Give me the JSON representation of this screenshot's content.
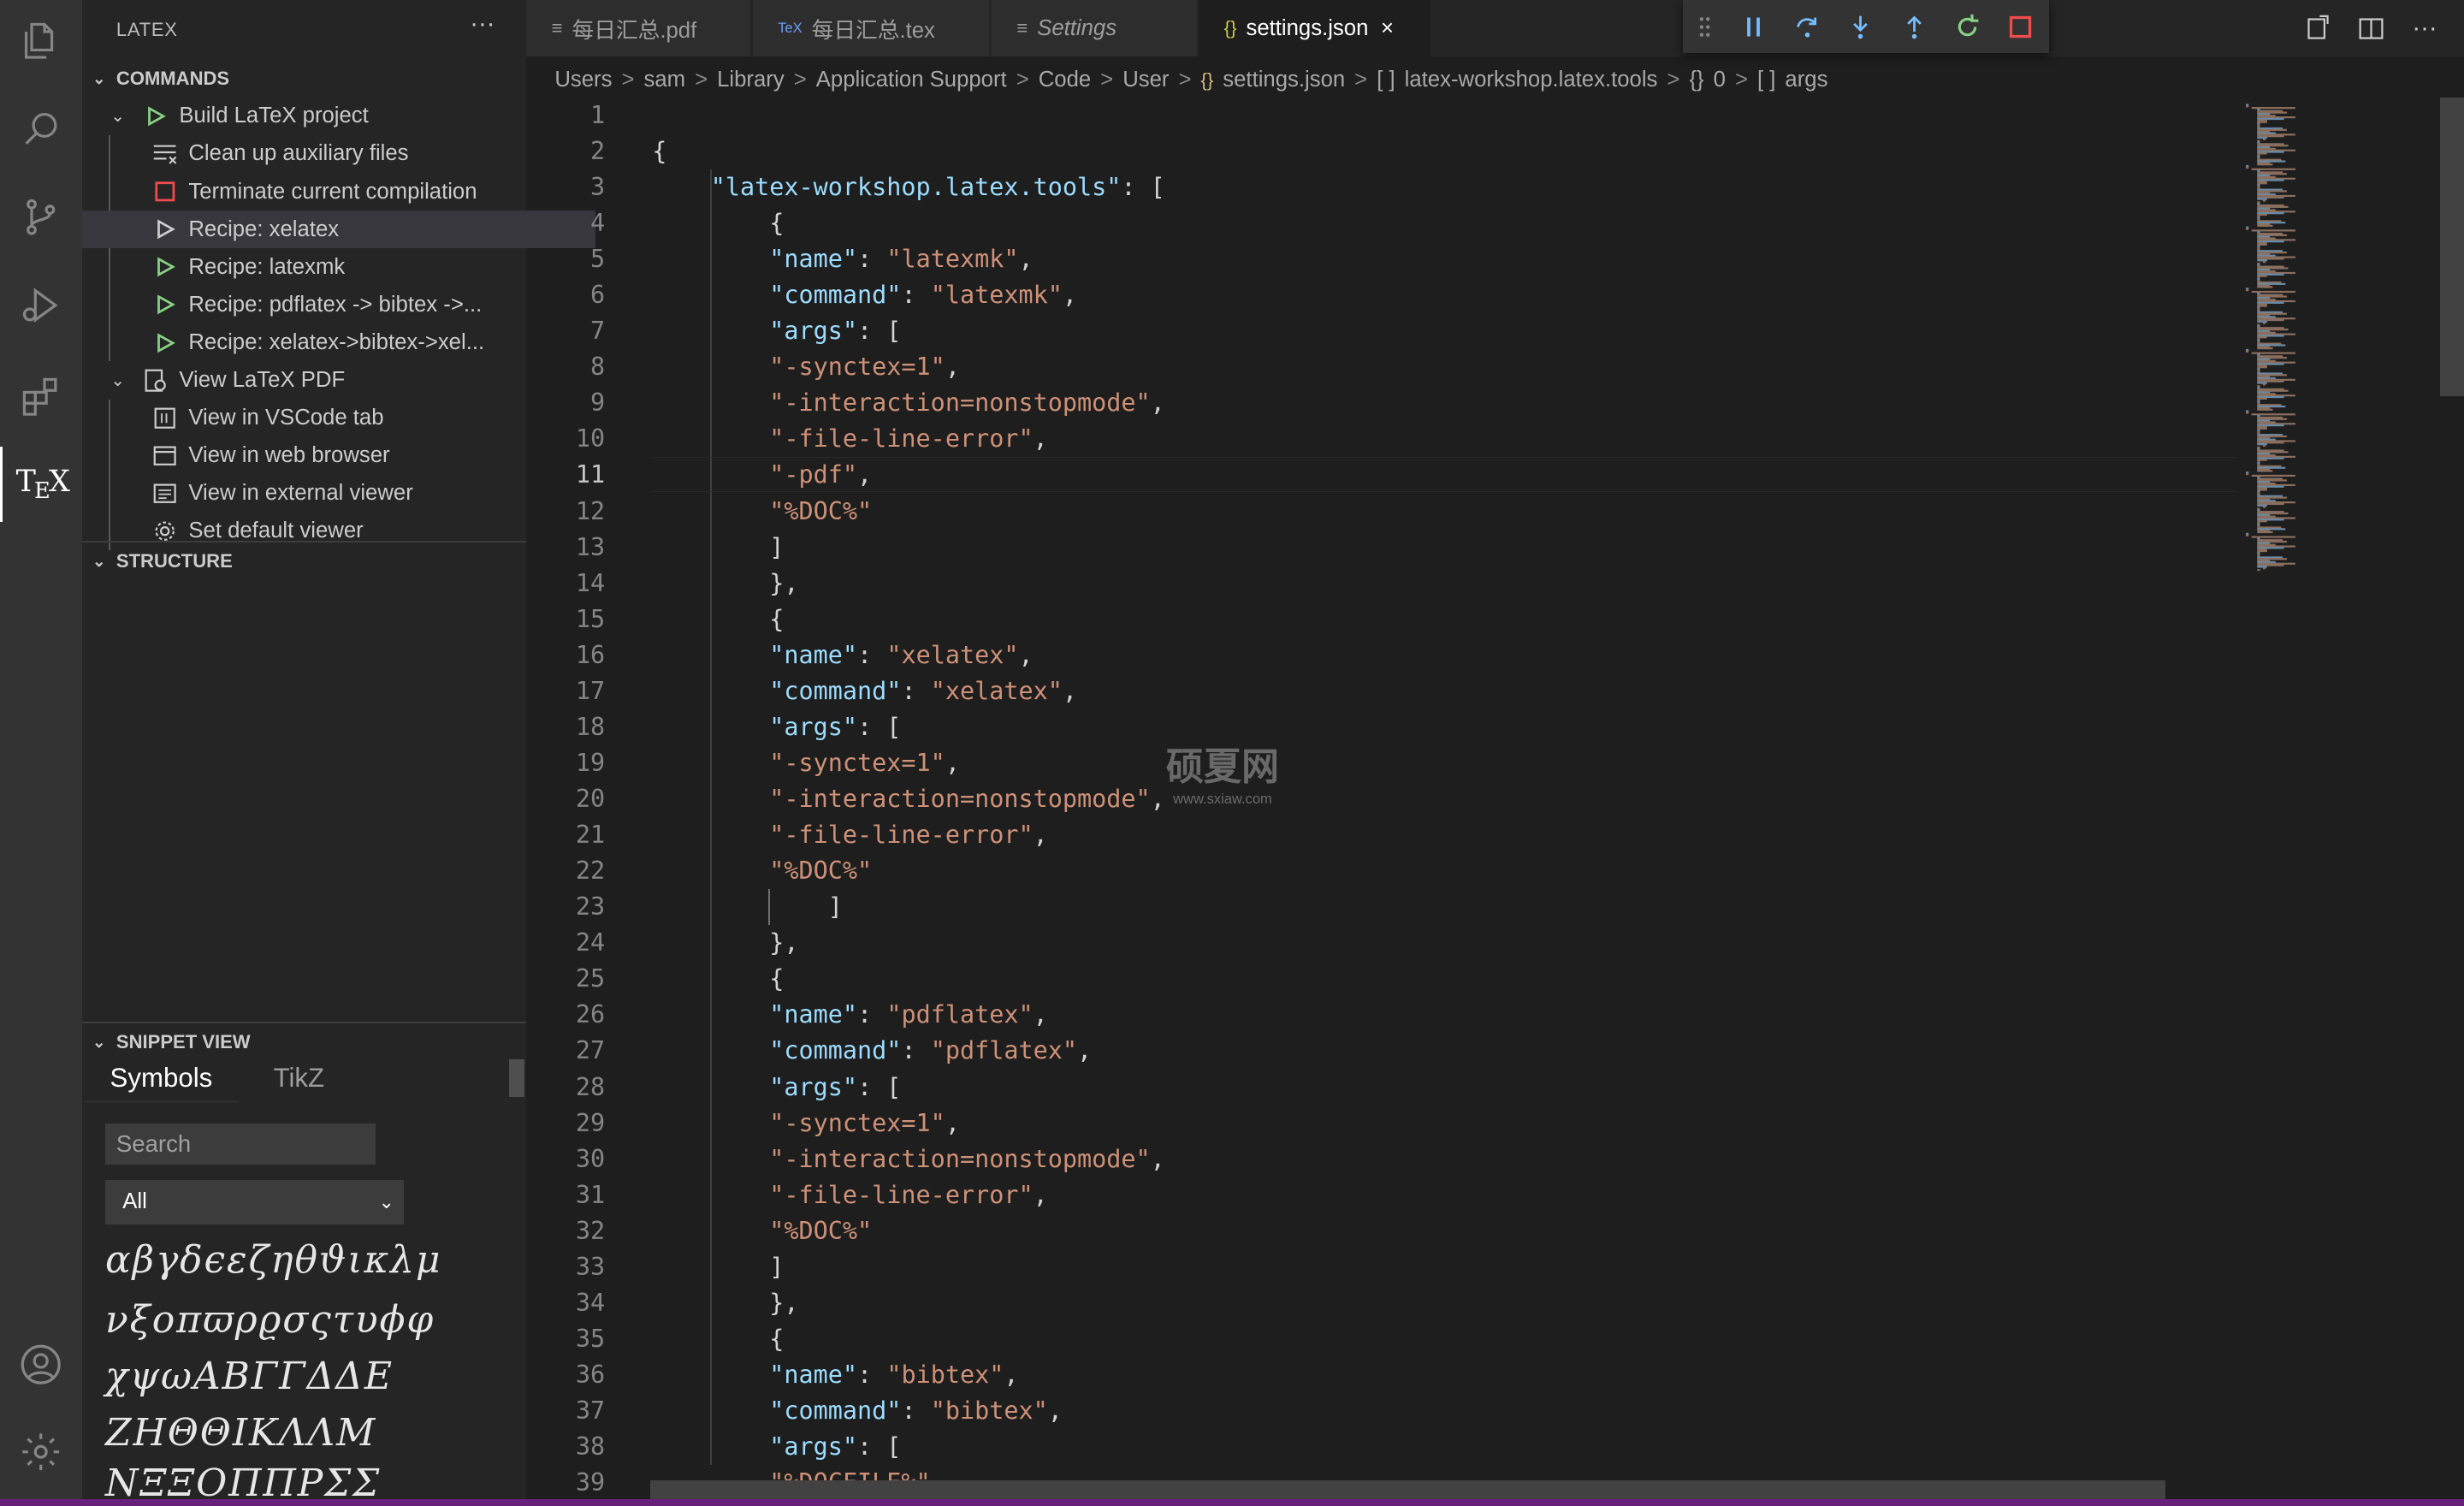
{
  "sidebar": {
    "title": "LATEX",
    "more": "···",
    "commands_section": "COMMANDS",
    "structure_section": "STRUCTURE",
    "snippet_section": "SNIPPET VIEW",
    "items": [
      {
        "label": "Build LaTeX project"
      },
      {
        "label": "Clean up auxiliary files"
      },
      {
        "label": "Terminate current compilation"
      },
      {
        "label": "Recipe: xelatex"
      },
      {
        "label": "Recipe: latexmk"
      },
      {
        "label": "Recipe: pdflatex -> bibtex ->..."
      },
      {
        "label": "Recipe: xelatex->bibtex->xel..."
      },
      {
        "label": "View LaTeX PDF"
      },
      {
        "label": "View in VSCode tab"
      },
      {
        "label": "View in web browser"
      },
      {
        "label": "View in external viewer"
      },
      {
        "label": "Set default viewer"
      }
    ],
    "snippet_tabs": [
      "Symbols",
      "TikZ"
    ],
    "search_placeholder": "Search",
    "filter_value": "All",
    "symbols": [
      "αβγδϵεζηθϑικλμ",
      "νξοπϖρϱσςτυϕφ",
      "χψωΑΒΓΓΔΔΕ",
      "ΖΗΘΘΙΚΛΛΜ",
      "ΝΞΞΟΠΠΡΣΣ"
    ]
  },
  "tabs": [
    {
      "icon": "≡",
      "label": "每日汇总.pdf"
    },
    {
      "icon": "TeX",
      "label": "每日汇总.tex"
    },
    {
      "icon": "≡",
      "label": "Settings"
    },
    {
      "icon": "{}",
      "label": "settings.json",
      "close": "×"
    }
  ],
  "breadcrumb": [
    "Users",
    "sam",
    "Library",
    "Application Support",
    "Code",
    "User",
    "settings.json",
    "latex-workshop.latex.tools",
    "0",
    "args"
  ],
  "breadcrumb_icons": {
    "file": "{}",
    "array": "[ ]",
    "object": "{}"
  },
  "editor": {
    "current_line": 11,
    "lines": [
      {
        "n": "1",
        "t": ""
      },
      {
        "n": "2",
        "t": "{"
      },
      {
        "n": "3",
        "t": "    \"latex-workshop.latex.tools\": ["
      },
      {
        "n": "4",
        "t": "        {"
      },
      {
        "n": "5",
        "t": "        \"name\": \"latexmk\","
      },
      {
        "n": "6",
        "t": "        \"command\": \"latexmk\","
      },
      {
        "n": "7",
        "t": "        \"args\": ["
      },
      {
        "n": "8",
        "t": "        \"-synctex=1\","
      },
      {
        "n": "9",
        "t": "        \"-interaction=nonstopmode\","
      },
      {
        "n": "10",
        "t": "        \"-file-line-error\","
      },
      {
        "n": "11",
        "t": "        \"-pdf\","
      },
      {
        "n": "12",
        "t": "        \"%DOC%\""
      },
      {
        "n": "13",
        "t": "        ]"
      },
      {
        "n": "14",
        "t": "        },"
      },
      {
        "n": "15",
        "t": "        {"
      },
      {
        "n": "16",
        "t": "        \"name\": \"xelatex\","
      },
      {
        "n": "17",
        "t": "        \"command\": \"xelatex\","
      },
      {
        "n": "18",
        "t": "        \"args\": ["
      },
      {
        "n": "19",
        "t": "        \"-synctex=1\","
      },
      {
        "n": "20",
        "t": "        \"-interaction=nonstopmode\","
      },
      {
        "n": "21",
        "t": "        \"-file-line-error\","
      },
      {
        "n": "22",
        "t": "        \"%DOC%\""
      },
      {
        "n": "23",
        "t": "            ]"
      },
      {
        "n": "24",
        "t": "        },"
      },
      {
        "n": "25",
        "t": "        {"
      },
      {
        "n": "26",
        "t": "        \"name\": \"pdflatex\","
      },
      {
        "n": "27",
        "t": "        \"command\": \"pdflatex\","
      },
      {
        "n": "28",
        "t": "        \"args\": ["
      },
      {
        "n": "29",
        "t": "        \"-synctex=1\","
      },
      {
        "n": "30",
        "t": "        \"-interaction=nonstopmode\","
      },
      {
        "n": "31",
        "t": "        \"-file-line-error\","
      },
      {
        "n": "32",
        "t": "        \"%DOC%\""
      },
      {
        "n": "33",
        "t": "        ]"
      },
      {
        "n": "34",
        "t": "        },"
      },
      {
        "n": "35",
        "t": "        {"
      },
      {
        "n": "36",
        "t": "        \"name\": \"bibtex\","
      },
      {
        "n": "37",
        "t": "        \"command\": \"bibtex\","
      },
      {
        "n": "38",
        "t": "        \"args\": ["
      },
      {
        "n": "39",
        "t": "        \"%DOCFILE%\""
      }
    ]
  },
  "watermark": {
    "big": "硕夏网",
    "small": "www.sxiaw.com"
  },
  "colors": {
    "accent": "#68217a",
    "key": "#9cdcfe",
    "string": "#ce9178",
    "green": "#89d185",
    "red": "#f14c4c"
  }
}
